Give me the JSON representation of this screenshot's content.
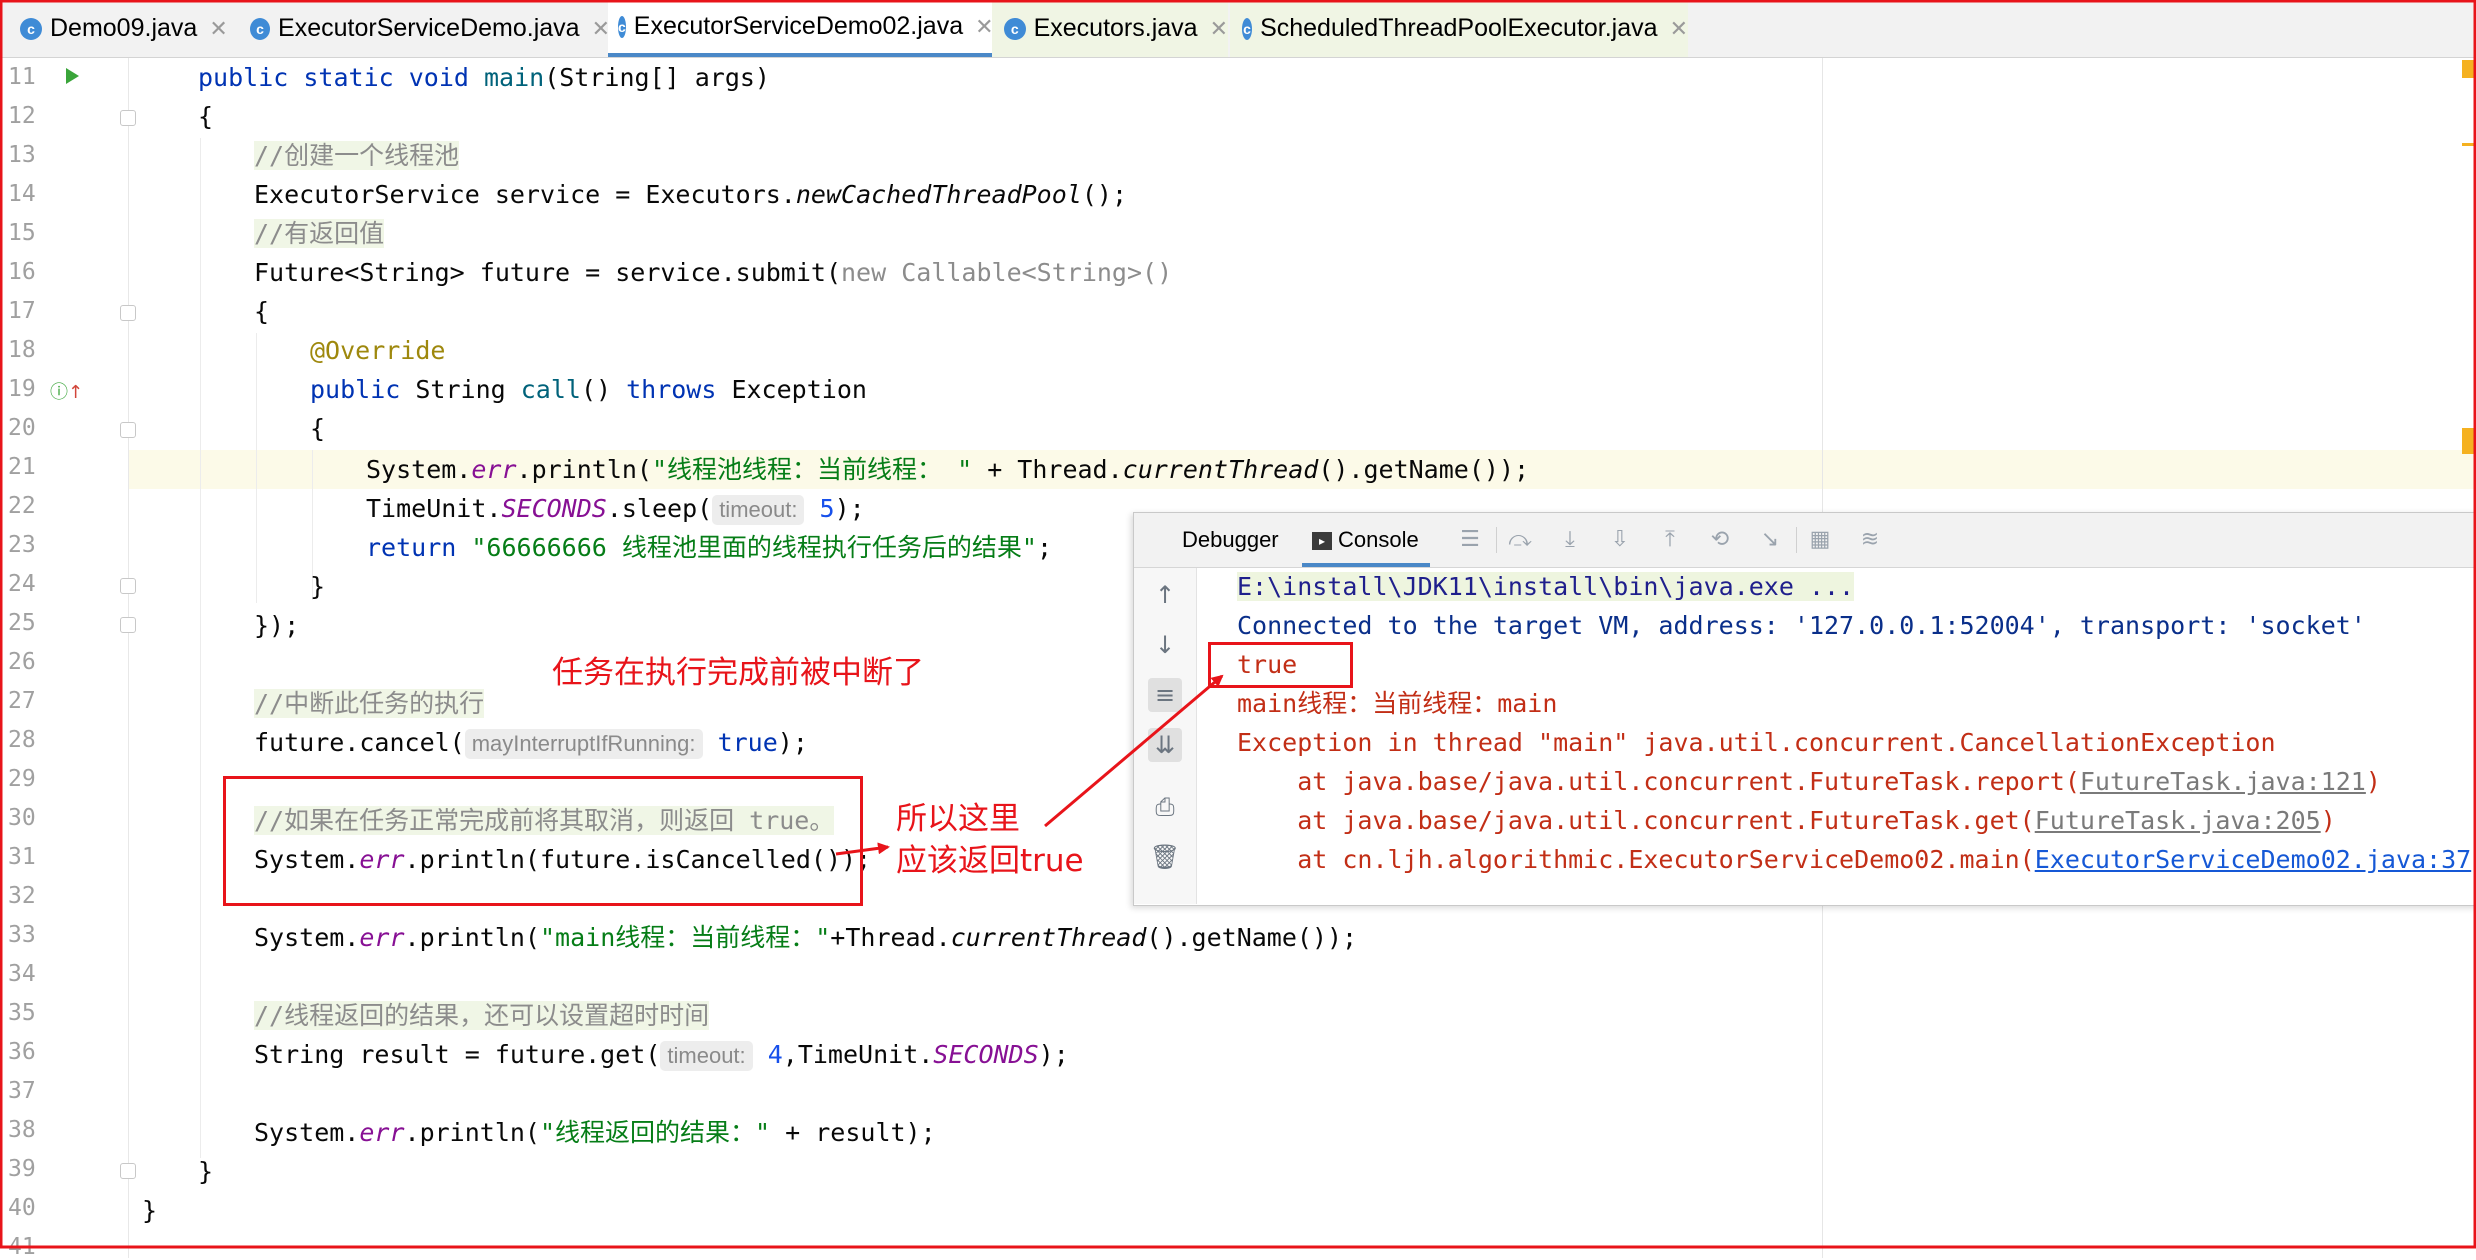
{
  "tabs": [
    {
      "label": "Demo09.java",
      "icon": "java-class-icon"
    },
    {
      "label": "ExecutorServiceDemo.java",
      "icon": "java-class-icon"
    },
    {
      "label": "ExecutorServiceDemo02.java",
      "icon": "java-class-icon",
      "active": true
    },
    {
      "label": "Executors.java",
      "icon": "java-class-icon"
    },
    {
      "label": "ScheduledThreadPoolExecutor.java",
      "icon": "java-class-icon"
    }
  ],
  "line_numbers": [
    "11",
    "12",
    "13",
    "14",
    "15",
    "16",
    "17",
    "18",
    "19",
    "20",
    "21",
    "22",
    "23",
    "24",
    "25",
    "26",
    "27",
    "28",
    "29",
    "30",
    "31",
    "32",
    "33",
    "34",
    "35",
    "36",
    "37",
    "38",
    "39",
    "40",
    "41"
  ],
  "code": {
    "l11": {
      "a": "public static void ",
      "b": "main",
      "c": "(String[] args)"
    },
    "l12": "{",
    "l13": "//创建一个线程池",
    "l14": {
      "a": "ExecutorService service = Executors.",
      "b": "newCachedThreadPool",
      "c": "();"
    },
    "l15": "//有返回值",
    "l16": {
      "a": "Future<String> future = service.submit(",
      "b": "new Callable<String>()"
    },
    "l17": "{",
    "l18": "@Override",
    "l19": {
      "a": "public ",
      "b": "String ",
      "c": "call",
      "d": "() ",
      "e": "throws",
      "f": " Exception"
    },
    "l20": "{",
    "l21": {
      "a": "System.",
      "b": "err",
      "c": ".println(",
      "d": "\"线程池线程：当前线程： \"",
      "e": " + Thread.",
      "f": "currentThread",
      "g": "().getName());"
    },
    "l22": {
      "a": "TimeUnit.",
      "b": "SECONDS",
      "c": ".sleep(",
      "hint": "timeout:",
      "d": "5",
      "e": ");"
    },
    "l23": {
      "a": "return ",
      "b": "\"66666666 线程池里面的线程执行任务后的结果\"",
      "c": ";"
    },
    "l24": "}",
    "l25": "});",
    "l27": "//中断此任务的执行",
    "l28": {
      "a": "future.cancel(",
      "hint": "mayInterruptIfRunning:",
      "b": "true",
      "c": ");"
    },
    "l30": "//如果在任务正常完成前将其取消，则返回 true。",
    "l31": {
      "a": "System.",
      "b": "err",
      "c": ".println(future.isCancelled());"
    },
    "l33": {
      "a": "System.",
      "b": "err",
      "c": ".println(",
      "d": "\"main线程：当前线程：\"",
      "e": "+Thread.",
      "f": "currentThread",
      "g": "().getName());"
    },
    "l35": "//线程返回的结果，还可以设置超时时间",
    "l36": {
      "a": "String result = future.get(",
      "hint": "timeout:",
      "b": "4",
      "c": ",TimeUnit.",
      "d": "SECONDS",
      "e": ");"
    },
    "l38": {
      "a": "System.",
      "b": "err",
      "c": ".println(",
      "d": "\"线程返回的结果：\"",
      "e": " + result);"
    },
    "l39": "}",
    "l40": "}"
  },
  "panel": {
    "tab_debugger": "Debugger",
    "tab_console": "Console",
    "console": {
      "cmd": "E:\\install\\JDK11\\install\\bin\\java.exe ...",
      "connected": "Connected to the target VM, address: '127.0.0.1:52004', transport: 'socket'",
      "true_line": "true",
      "main_line": "main线程：当前线程：main",
      "exception": "Exception in thread \"main\" java.util.concurrent.CancellationException",
      "at1_prefix": "    at java.base/java.util.concurrent.FutureTask.report(",
      "at1_link": "FutureTask.java:121",
      "at2_prefix": "    at java.base/java.util.concurrent.FutureTask.get(",
      "at2_link": "FutureTask.java:205",
      "at3_prefix": "    at cn.ljh.algorithmic.ExecutorServiceDemo02.main(",
      "at3_link": "ExecutorServiceDemo02.java:37",
      "close_paren": ")"
    }
  },
  "annotations": {
    "interrupted": "任务在执行完成前被中断了",
    "so_here_1": "所以这里",
    "so_here_2": "应该返回true"
  },
  "colors": {
    "annotation_red": "#e8141a",
    "keyword": "#0033b3",
    "string": "#067d17",
    "comment": "#8c8c8c",
    "active_tab": "#4a88c7"
  }
}
